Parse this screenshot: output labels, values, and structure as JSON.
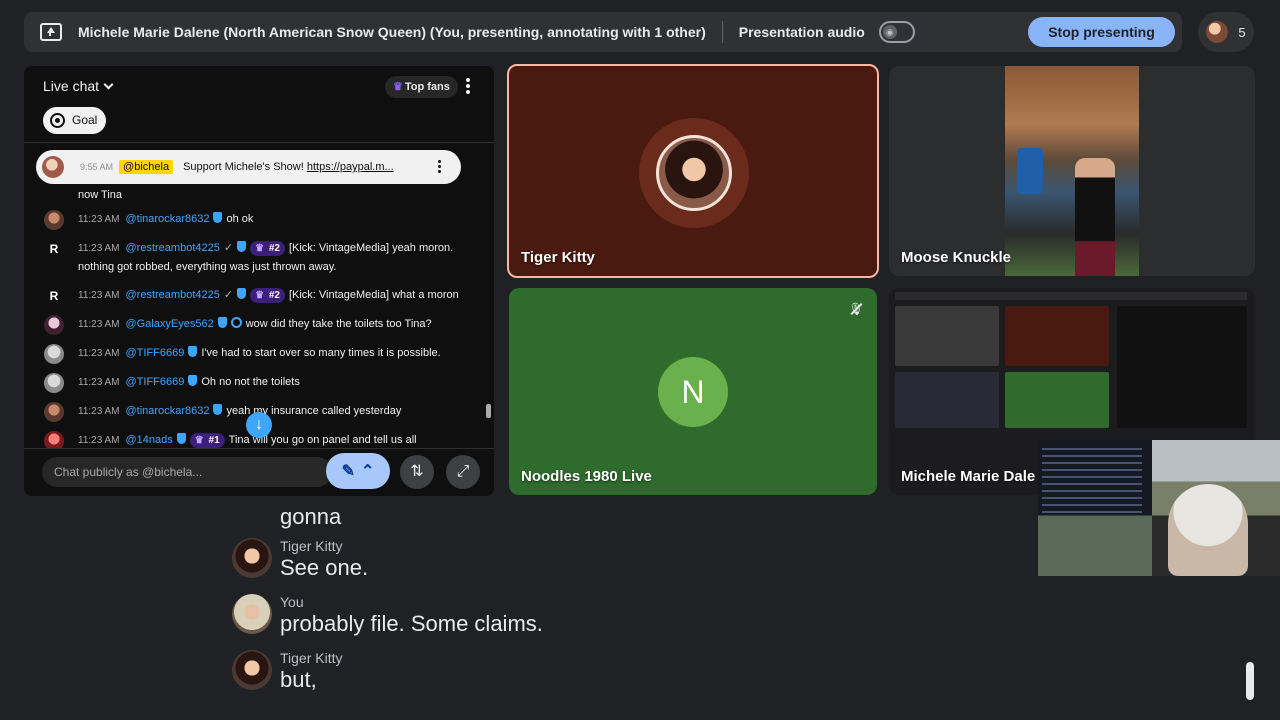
{
  "topbar": {
    "title": "Michele Marie Dalene (North American Snow Queen) (You, presenting, annotating with 1 other)",
    "audio_label": "Presentation audio",
    "stop_label": "Stop presenting",
    "participant_count": "5"
  },
  "chat": {
    "title": "Live chat",
    "top_fans": "Top fans",
    "goal": "Goal",
    "pinned": {
      "time": "9:55 AM",
      "user": "@bichela",
      "text": "Support Michele's Show! ",
      "link": "https://paypal.m..."
    },
    "first_line": "now Tina",
    "messages": [
      {
        "time": "11:23 AM",
        "user": "@tinarockar8632",
        "text": "oh ok"
      },
      {
        "time": "11:23 AM",
        "user": "@restreambot4225",
        "rank": "#2",
        "text": "[Kick: VintageMedia] yeah moron. nothing got robbed, everything was just thrown away."
      },
      {
        "time": "11:23 AM",
        "user": "@restreambot4225",
        "rank": "#2",
        "text": "[Kick: VintageMedia] what a moron"
      },
      {
        "time": "11:23 AM",
        "user": "@GalaxyEyes562",
        "text": "wow did they take the toilets too Tina?"
      },
      {
        "time": "11:23 AM",
        "user": "@TIFF6669",
        "text": "I've had to start over so many times it is possible."
      },
      {
        "time": "11:23 AM",
        "user": "@TIFF6669",
        "text": "Oh no not the toilets"
      },
      {
        "time": "11:23 AM",
        "user": "@tinarockar8632",
        "text": "yeah my insurance called yesterday"
      },
      {
        "time": "11:23 AM",
        "user": "@14nads",
        "rank": "#1",
        "text": "Tina will you go on panel and tell us all"
      }
    ],
    "input_placeholder": "Chat publicly as @bichela..."
  },
  "tiles": {
    "tiger": "Tiger Kitty",
    "moose": "Moose Knuckle",
    "noodles": "Noodles 1980 Live",
    "noodles_initial": "N",
    "screen": "Michele Marie Dale"
  },
  "captions": [
    {
      "speaker": "",
      "text": "gonna"
    },
    {
      "speaker": "Tiger Kitty",
      "text": "See one."
    },
    {
      "speaker": "You",
      "text": "probably file. Some claims."
    },
    {
      "speaker": "Tiger Kitty",
      "text": "but,"
    }
  ],
  "colors": {
    "accent": "#8ab4f8",
    "chat_username": "#3ea6ff",
    "tiger_tile": "#4a1a10",
    "noodles_tile": "#2f6b2d"
  }
}
